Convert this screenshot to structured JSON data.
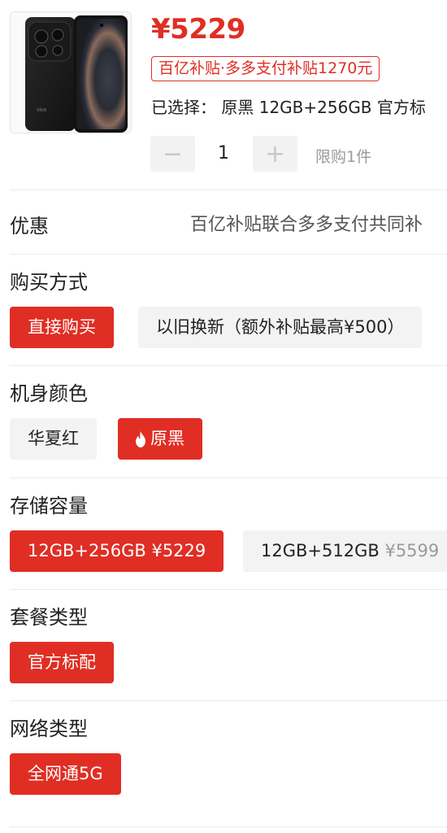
{
  "product": {
    "price": "¥5229",
    "subsidy_tag": "百亿补贴·多多支付补贴1270元",
    "selected": "已选择： 原黑 12GB+256GB 官方标",
    "quantity": "1",
    "limit": "限购1件",
    "minus_label": "−",
    "plus_label": "+"
  },
  "promo": {
    "label": "优惠",
    "text": "百亿补贴联合多多支付共同补"
  },
  "purchase": {
    "title": "购买方式",
    "options": [
      "直接购买",
      "以旧换新（额外补贴最高¥500）"
    ]
  },
  "color": {
    "title": "机身颜色",
    "options": [
      "华夏红",
      "原黑"
    ]
  },
  "storage": {
    "title": "存储容量",
    "options": [
      {
        "label": "12GB+256GB",
        "price": "¥5229"
      },
      {
        "label": "12GB+512GB",
        "price": "¥5599"
      }
    ]
  },
  "package": {
    "title": "套餐类型",
    "options": [
      "官方标配"
    ]
  },
  "network": {
    "title": "网络类型",
    "options": [
      "全网通5G"
    ]
  },
  "colors": {
    "accent": "#e02e24",
    "inactive_bg": "#f3f3f3",
    "divider": "#ececec"
  }
}
